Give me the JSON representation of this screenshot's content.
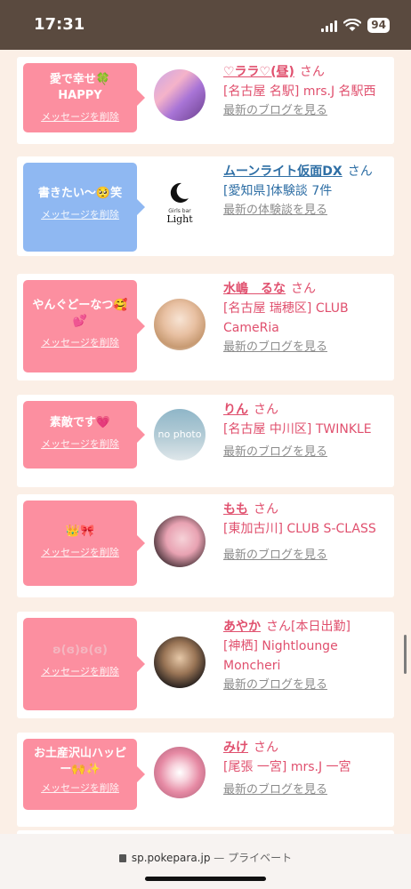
{
  "status": {
    "time": "17:31",
    "battery": "94"
  },
  "colors": {
    "pink": "#fc8fa0",
    "blue": "#8fb8f2",
    "name_pink": "#e0506e",
    "name_blue": "#2f6fa5",
    "link_gray": "#8c8c8c"
  },
  "cards": [
    {
      "message": "愛で幸せ🍀 HAPPY",
      "delete": "メッセージを削除",
      "name": "♡ララ♡(昼)",
      "san": "さん",
      "extra": "",
      "detail": "[名古屋 名駅] mrs.J 名駅西",
      "link": "最新のブログを見る"
    },
    {
      "message": "書きたい〜🥺笑",
      "delete": "メッセージを削除",
      "name": "ムーンライト仮面DX",
      "san": "さん",
      "extra": "",
      "detail": "[愛知県]体験談 7件",
      "link": "最新の体験談を見る",
      "logo": "Light",
      "logo_small": "Girls bar"
    },
    {
      "message": "やんぐどーなつ🥰💕",
      "delete": "メッセージを削除",
      "name": "水嶋　るな",
      "san": "さん",
      "extra": "",
      "detail": "[名古屋 瑞穂区] CLUB CameRia",
      "link": "最新のブログを見る"
    },
    {
      "message": "素敵です💗",
      "delete": "メッセージを削除",
      "name": "りん",
      "san": "さん",
      "extra": "",
      "detail": "[名古屋 中川区] TWINKLE",
      "link": "最新のブログを見る",
      "avatar_text": "no photo"
    },
    {
      "message": "👑🎀",
      "delete": "メッセージを削除",
      "name": "もも",
      "san": "さん",
      "extra": "",
      "detail": "[東加古川] CLUB S-CLASS",
      "link": "最新のブログを見る"
    },
    {
      "message": "ʚ(ɞ)ʚ(ɞ)",
      "delete": "メッセージを削除",
      "name": "あやか",
      "san": "さん",
      "extra": "[本日出勤]",
      "detail": "[神栖] Nightlounge Moncheri",
      "link": "最新のブログを見る"
    },
    {
      "message": "お土産沢山ハッピー🙌✨",
      "delete": "メッセージを削除",
      "name": "みけ",
      "san": "さん",
      "extra": "",
      "detail": "[尾張 一宮] mrs.J 一宮",
      "link": "最新のブログを見る"
    }
  ],
  "browser": {
    "url": "sp.pokepara.jp",
    "private": "— プライベート"
  }
}
